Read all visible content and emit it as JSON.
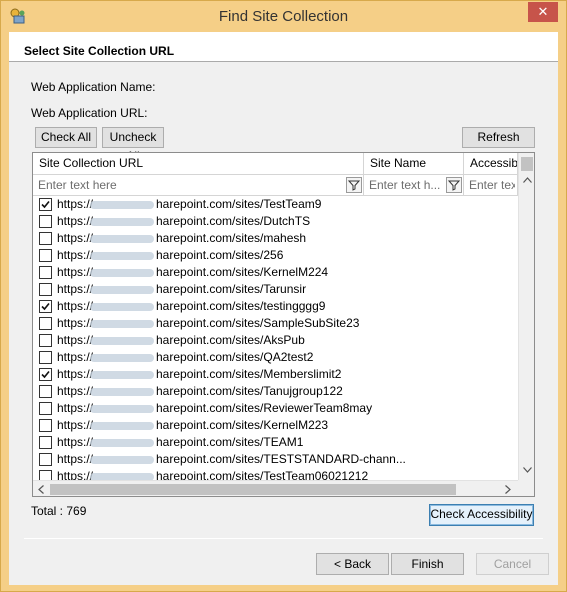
{
  "window": {
    "title": "Find Site Collection",
    "close_glyph": "✕"
  },
  "section_title": "Select Site Collection URL",
  "labels": {
    "web_app_name": "Web Application Name:",
    "web_app_url": "Web Application URL:"
  },
  "buttons": {
    "check_all": "Check All",
    "uncheck_all": "Uncheck All",
    "refresh": "Refresh",
    "check_accessibility": "Check Accessibility",
    "back": "< Back",
    "finish": "Finish",
    "cancel": "Cancel"
  },
  "grid": {
    "columns": [
      {
        "title": "Site Collection URL",
        "filter_placeholder": "Enter text here"
      },
      {
        "title": "Site Name",
        "filter_placeholder": "Enter text h..."
      },
      {
        "title": "Accessibili",
        "filter_placeholder": "Enter tex"
      }
    ],
    "url_prefix": "https://",
    "rows": [
      {
        "checked": true,
        "url_rest": "harepoint.com/sites/TestTeam9"
      },
      {
        "checked": false,
        "url_rest": "harepoint.com/sites/DutchTS"
      },
      {
        "checked": false,
        "url_rest": "harepoint.com/sites/mahesh"
      },
      {
        "checked": false,
        "url_rest": "harepoint.com/sites/256"
      },
      {
        "checked": false,
        "url_rest": "harepoint.com/sites/KernelM224"
      },
      {
        "checked": false,
        "url_rest": "harepoint.com/sites/Tarunsir"
      },
      {
        "checked": true,
        "url_rest": "harepoint.com/sites/testingggg9"
      },
      {
        "checked": false,
        "url_rest": "harepoint.com/sites/SampleSubSite23"
      },
      {
        "checked": false,
        "url_rest": "harepoint.com/sites/AksPub"
      },
      {
        "checked": false,
        "url_rest": "harepoint.com/sites/QA2test2"
      },
      {
        "checked": true,
        "url_rest": "harepoint.com/sites/Memberslimit2"
      },
      {
        "checked": false,
        "url_rest": "harepoint.com/sites/Tanujgroup122"
      },
      {
        "checked": false,
        "url_rest": "harepoint.com/sites/ReviewerTeam8may"
      },
      {
        "checked": false,
        "url_rest": "harepoint.com/sites/KernelM223"
      },
      {
        "checked": false,
        "url_rest": "harepoint.com/sites/TEAM1"
      },
      {
        "checked": false,
        "url_rest": "harepoint.com/sites/TESTSTANDARD-chann..."
      },
      {
        "checked": false,
        "url_rest": "harepoint.com/sites/TestTeam06021212"
      }
    ]
  },
  "total_text": "Total : 769",
  "icons": {
    "app": "app-icon",
    "close": "close-icon",
    "filter": "filter-icon",
    "scroll_up": "chevron-up-icon",
    "scroll_down": "chevron-down-icon",
    "scroll_left": "chevron-left-icon",
    "scroll_right": "chevron-right-icon"
  },
  "colors": {
    "title_bar": "#f5cf87",
    "close_button": "#c7544a",
    "focus_border": "#3c7fb1"
  }
}
